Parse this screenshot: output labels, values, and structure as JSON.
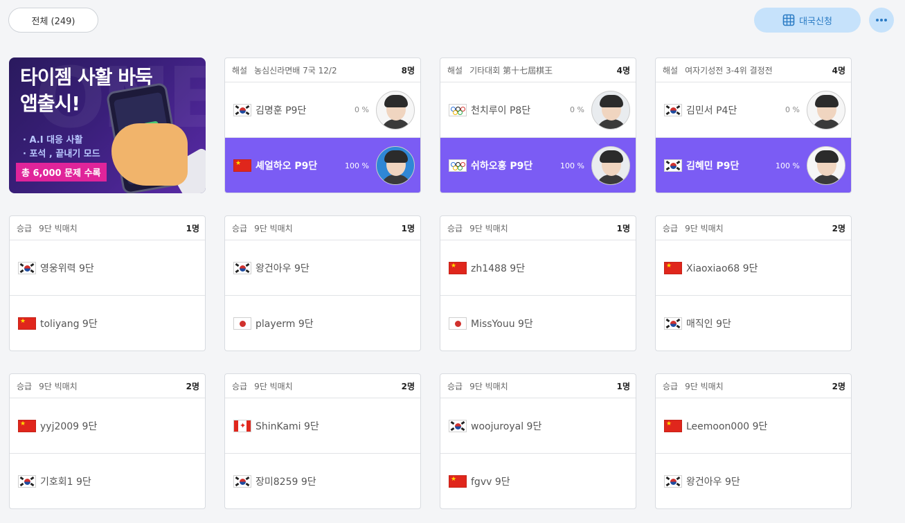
{
  "toolbar": {
    "filter_label": "전체 (249)",
    "apply_label": "대국신청",
    "apply_icon": "grid-icon",
    "more_icon": "more-icon"
  },
  "banner": {
    "title": "타이젬 사활 바둑\n앱출시!",
    "bullet1": "· A.I 대응 사활",
    "bullet2": "· 포석 , 끝내기 모드",
    "badge": "총 6,000 문제 수록",
    "watermark": "ONE"
  },
  "cards": [
    {
      "kind": "해설",
      "desc": "농심신라면배 7국 12/2",
      "count": "8명",
      "players": [
        {
          "flag": "kr",
          "name": "김명훈 P9단",
          "pct": "0 %",
          "winner": false,
          "avatar": "light"
        },
        {
          "flag": "cn",
          "name": "셰얼하오 P9단",
          "pct": "100 %",
          "winner": true,
          "avatar": "blue"
        }
      ]
    },
    {
      "kind": "해설",
      "desc": "기타대회 第十七屆棋王",
      "count": "4명",
      "players": [
        {
          "flag": "ol",
          "name": "천치루이 P8단",
          "pct": "0 %",
          "winner": false,
          "avatar": "default"
        },
        {
          "flag": "ol",
          "name": "쉬하오훙 P9단",
          "pct": "100 %",
          "winner": true,
          "avatar": "default"
        }
      ]
    },
    {
      "kind": "해설",
      "desc": "여자기성전 3-4위 결정전",
      "count": "4명",
      "players": [
        {
          "flag": "kr",
          "name": "김민서 P4단",
          "pct": "0 %",
          "winner": false,
          "avatar": "light"
        },
        {
          "flag": "kr",
          "name": "김혜민 P9단",
          "pct": "100 %",
          "winner": true,
          "avatar": "light"
        }
      ]
    },
    {
      "kind": "승급",
      "desc": "9단 빅매치",
      "count": "1명",
      "players": [
        {
          "flag": "kr",
          "name": "영웅위력 9단"
        },
        {
          "flag": "cn",
          "name": "toliyang 9단"
        }
      ]
    },
    {
      "kind": "승급",
      "desc": "9단 빅매치",
      "count": "1명",
      "players": [
        {
          "flag": "kr",
          "name": "왕건아우 9단"
        },
        {
          "flag": "jp",
          "name": "playerm 9단"
        }
      ]
    },
    {
      "kind": "승급",
      "desc": "9단 빅매치",
      "count": "1명",
      "players": [
        {
          "flag": "cn",
          "name": "zh1488 9단"
        },
        {
          "flag": "jp",
          "name": "MissYouu 9단"
        }
      ]
    },
    {
      "kind": "승급",
      "desc": "9단 빅매치",
      "count": "2명",
      "players": [
        {
          "flag": "cn",
          "name": "Xiaoxiao68 9단"
        },
        {
          "flag": "kr",
          "name": "매직인 9단"
        }
      ]
    },
    {
      "kind": "승급",
      "desc": "9단 빅매치",
      "count": "2명",
      "players": [
        {
          "flag": "cn",
          "name": "yyj2009 9단"
        },
        {
          "flag": "kr",
          "name": "기호회1 9단"
        }
      ]
    },
    {
      "kind": "승급",
      "desc": "9단 빅매치",
      "count": "2명",
      "players": [
        {
          "flag": "ca",
          "name": "ShinKami 9단"
        },
        {
          "flag": "kr",
          "name": "장미8259 9단"
        }
      ]
    },
    {
      "kind": "승급",
      "desc": "9단 빅매치",
      "count": "1명",
      "players": [
        {
          "flag": "kr",
          "name": "woojuroyal 9단"
        },
        {
          "flag": "cn",
          "name": "fgvv 9단"
        }
      ]
    },
    {
      "kind": "승급",
      "desc": "9단 빅매치",
      "count": "2명",
      "players": [
        {
          "flag": "cn",
          "name": "Leemoon000 9단"
        },
        {
          "flag": "kr",
          "name": "왕건아우 9단"
        }
      ]
    }
  ]
}
